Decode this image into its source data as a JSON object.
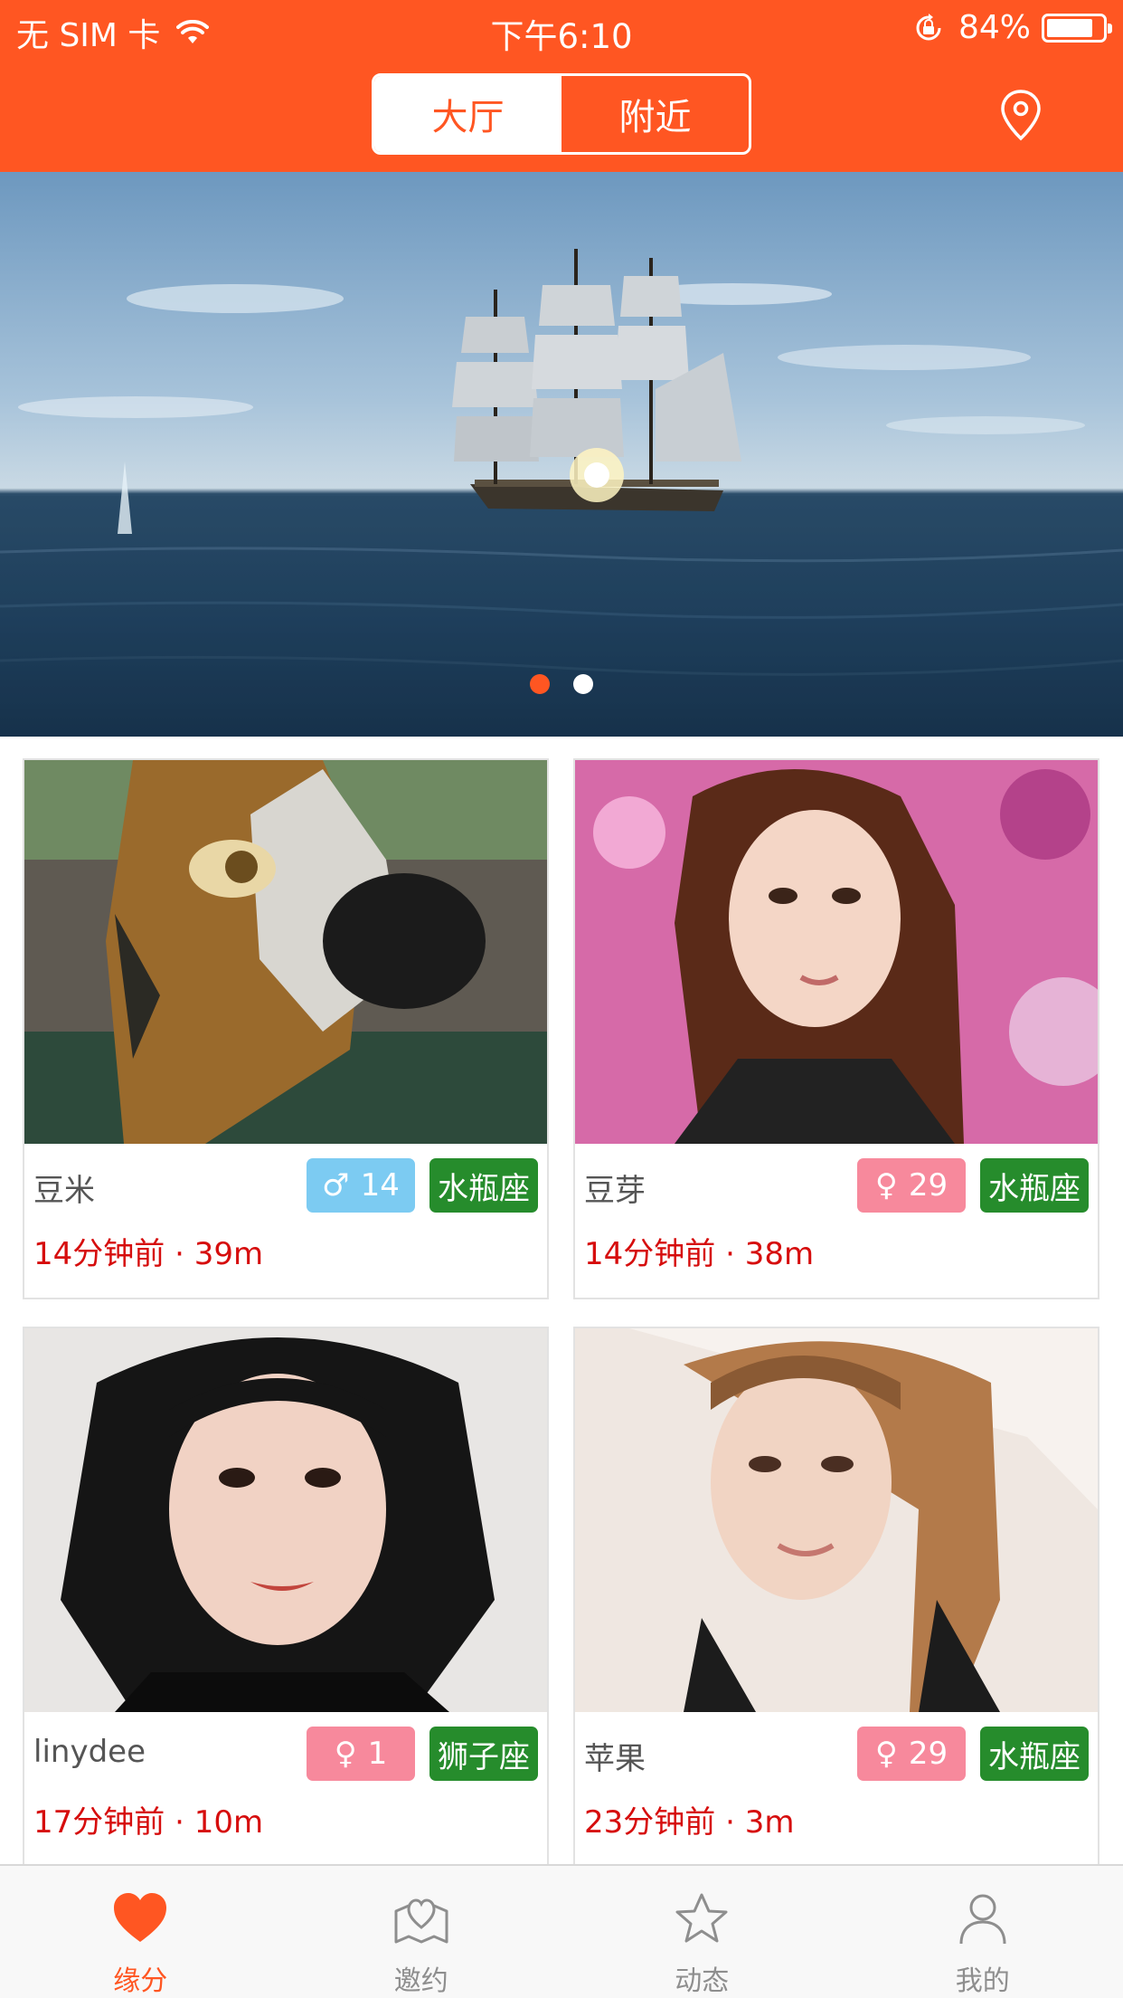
{
  "colors": {
    "brand": "#ff5622",
    "male_badge": "#7ccbf2",
    "female_badge": "#f7899c",
    "zodiac_badge": "#268c2c",
    "meta_text": "#d60d0d",
    "tab_inactive": "#8e8e8e"
  },
  "status_bar": {
    "carrier": "无 SIM 卡",
    "time": "下午6:10",
    "battery_text": "84%",
    "battery_level": 0.84
  },
  "header": {
    "segments": [
      {
        "label": "大厅",
        "active": true
      },
      {
        "label": "附近",
        "active": false
      }
    ],
    "location_icon": "location-pin-icon"
  },
  "banner": {
    "image": "sailing-ship-at-sea",
    "page_count": 2,
    "current_page": 1
  },
  "cards": [
    {
      "name": "豆米",
      "gender_symbol": "♂",
      "gender": "male",
      "age": "14",
      "zodiac": "水瓶座",
      "time_ago": "14分钟前",
      "separator": "·",
      "distance": "39m",
      "photo": "dog-statue-photo"
    },
    {
      "name": "豆芽",
      "gender_symbol": "♀",
      "gender": "female",
      "age": "29",
      "zodiac": "水瓶座",
      "time_ago": "14分钟前",
      "separator": "·",
      "distance": "38m",
      "photo": "woman-portrait-photo"
    },
    {
      "name": "linydee",
      "gender_symbol": "♀",
      "gender": "female",
      "age": "1",
      "zodiac": "狮子座",
      "time_ago": "17分钟前",
      "separator": "·",
      "distance": "10m",
      "photo": "woman-portrait-photo"
    },
    {
      "name": "苹果",
      "gender_symbol": "♀",
      "gender": "female",
      "age": "29",
      "zodiac": "水瓶座",
      "time_ago": "23分钟前",
      "separator": "·",
      "distance": "3m",
      "photo": "woman-portrait-photo"
    }
  ],
  "tabbar": {
    "items": [
      {
        "label": "缘分",
        "icon": "heart-icon",
        "active": true
      },
      {
        "label": "邀约",
        "icon": "map-heart-icon",
        "active": false
      },
      {
        "label": "动态",
        "icon": "star-icon",
        "active": false
      },
      {
        "label": "我的",
        "icon": "person-icon",
        "active": false
      }
    ]
  }
}
